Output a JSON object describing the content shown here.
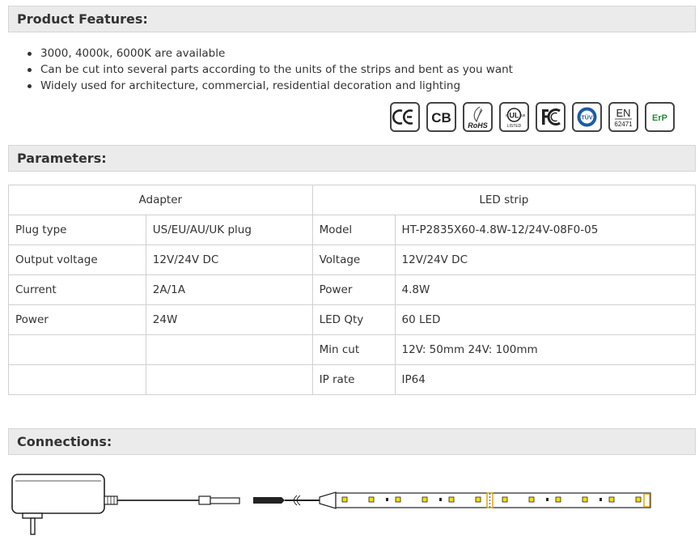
{
  "features": {
    "title": "Product Features:",
    "items": [
      "3000, 4000k, 6000K are available",
      "Can be cut into several parts according to the units of the strips and bent as you want",
      "Widely used for architecture, commercial, residential decoration and lighting"
    ],
    "certifications": [
      {
        "icon": "ce-mark-icon",
        "text": "CE"
      },
      {
        "icon": "cb-mark-icon",
        "text": "CB"
      },
      {
        "icon": "rohs-mark-icon",
        "text": "RoHS"
      },
      {
        "icon": "ul-listed-mark-icon",
        "text": "UL",
        "sub": "LISTED"
      },
      {
        "icon": "fc-mark-icon",
        "text": "FC"
      },
      {
        "icon": "tuv-mark-icon",
        "text": "TÜV"
      },
      {
        "icon": "en-62471-mark-icon",
        "text": "EN",
        "sub": "62471"
      },
      {
        "icon": "erp-mark-icon",
        "text": "ErP"
      }
    ]
  },
  "parameters": {
    "title": "Parameters:",
    "adapter_header": "Adapter",
    "strip_header": "LED strip",
    "rows": [
      {
        "a_label": "Plug type",
        "a_value": "US/EU/AU/UK plug",
        "s_label": "Model",
        "s_value": "HT-P2835X60-4.8W-12/24V-08F0-05"
      },
      {
        "a_label": "Output voltage",
        "a_value": "12V/24V DC",
        "s_label": "Voltage",
        "s_value": "12V/24V DC"
      },
      {
        "a_label": "Current",
        "a_value": "2A/1A",
        "s_label": "Power",
        "s_value": "4.8W"
      },
      {
        "a_label": "Power",
        "a_value": "24W",
        "s_label": "LED Qty",
        "s_value": "60 LED"
      },
      {
        "a_label": "",
        "a_value": "",
        "s_label": "Min cut",
        "s_value": "12V: 50mm 24V: 100mm"
      },
      {
        "a_label": "",
        "a_value": "",
        "s_label": "IP rate",
        "s_value": "IP64"
      }
    ]
  },
  "connections": {
    "title": "Connections:"
  },
  "colors": {
    "header_bg": "#ebebeb",
    "led": "#f5e000",
    "cut_mark": "#e0a000"
  }
}
